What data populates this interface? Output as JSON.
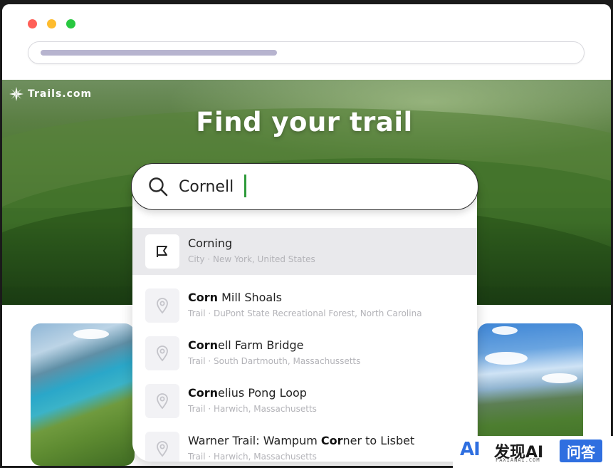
{
  "browser": {
    "traffic_lights": [
      "close",
      "minimize",
      "maximize"
    ],
    "colors": {
      "close": "#ff5f57",
      "minimize": "#febc2e",
      "maximize": "#28c840"
    }
  },
  "brand": {
    "name": "Trails.com",
    "icon": "compass-star-icon"
  },
  "hero": {
    "title": "Find your trail"
  },
  "search": {
    "value": "Cornell",
    "icon": "search-icon",
    "caret_color": "#2e9b3a"
  },
  "results": [
    {
      "icon": "city-flag-icon",
      "match": "",
      "rest": "Corning",
      "subtitle": "City · New York, United States",
      "selected": true
    },
    {
      "icon": "map-pin-icon",
      "match": "Corn",
      "rest": " Mill Shoals",
      "subtitle": "Trail · DuPont State Recreational Forest, North Carolina",
      "selected": false
    },
    {
      "icon": "map-pin-icon",
      "match": "Corn",
      "rest": "ell Farm Bridge",
      "subtitle": "Trail · South Dartmouth, Massachussetts",
      "selected": false
    },
    {
      "icon": "map-pin-icon",
      "match": "Corn",
      "rest": "elius Pong Loop",
      "subtitle": "Trail · Harwich, Massachusetts",
      "selected": false
    },
    {
      "icon": "map-pin-icon",
      "prefix": "Warner Trail: Wampum ",
      "match": "Cor",
      "rest": "ner to Lisbet",
      "subtitle": "Trail · Harwich, Massachusetts",
      "selected": false
    }
  ],
  "watermark": {
    "logo": "AI",
    "text": "发现AI",
    "sub": "FAXIANAI.COM",
    "badge": "问答"
  }
}
